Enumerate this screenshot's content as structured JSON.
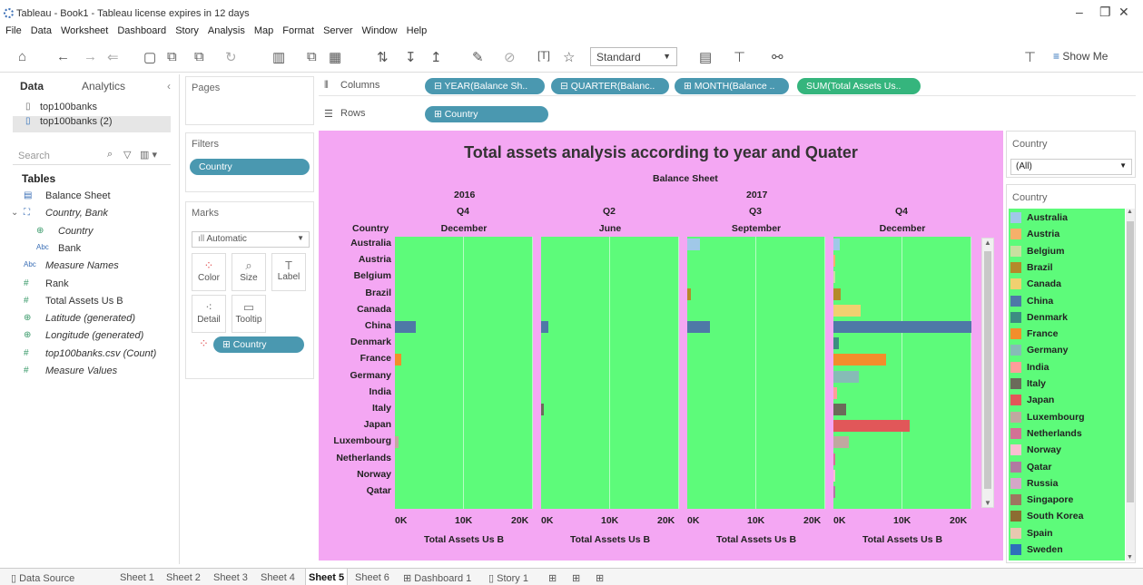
{
  "window": {
    "title": "Tableau - Book1 - Tableau license expires in 12 days"
  },
  "menu": [
    "File",
    "Data",
    "Worksheet",
    "Dashboard",
    "Story",
    "Analysis",
    "Map",
    "Format",
    "Server",
    "Window",
    "Help"
  ],
  "toolbar": {
    "fit": "Standard",
    "show_me": "Show Me"
  },
  "left": {
    "tab_data": "Data",
    "tab_analytics": "Analytics",
    "sources": [
      "top100banks",
      "top100banks (2)"
    ],
    "search_placeholder": "Search",
    "tables_label": "Tables",
    "fields": [
      {
        "icon": "table-icon",
        "label": "Balance Sheet",
        "indent": 0
      },
      {
        "icon": "hierarchy-icon",
        "label": "Country, Bank",
        "indent": 0
      },
      {
        "icon": "globe-icon",
        "label": "Country",
        "indent": 1
      },
      {
        "icon": "abc-icon",
        "label": "Bank",
        "indent": 1
      },
      {
        "icon": "abc-icon",
        "label": "Measure Names",
        "indent": 0
      },
      {
        "icon": "hash-icon",
        "label": "Rank",
        "indent": 0
      },
      {
        "icon": "hash-icon",
        "label": "Total Assets Us B",
        "indent": 0
      },
      {
        "icon": "globe-icon",
        "label": "Latitude (generated)",
        "indent": 0
      },
      {
        "icon": "globe-icon",
        "label": "Longitude (generated)",
        "indent": 0
      },
      {
        "icon": "hash-icon",
        "label": "top100banks.csv (Count)",
        "indent": 0
      },
      {
        "icon": "hash-icon",
        "label": "Measure Values",
        "indent": 0
      }
    ]
  },
  "shelves": {
    "pages": "Pages",
    "filters": "Filters",
    "filter_pill": "Country",
    "marks": "Marks",
    "marks_type": "Automatic",
    "mark_buttons": [
      "Color",
      "Size",
      "Label",
      "Detail",
      "Tooltip"
    ],
    "marks_pill": "Country",
    "columns_label": "Columns",
    "rows_label": "Rows",
    "columns": [
      "YEAR(Balance Sh..",
      "QUARTER(Balanc..",
      "MONTH(Balance ..",
      "SUM(Total Assets Us.."
    ],
    "rows": [
      "Country"
    ]
  },
  "viz": {
    "title": "Total assets analysis according to year and Quater",
    "header_top": "Balance Sheet",
    "row_header": "Country",
    "years": [
      {
        "label": "2016"
      },
      {
        "label": "2017"
      }
    ],
    "panes": [
      {
        "quarter": "Q4",
        "month": "December"
      },
      {
        "quarter": "Q2",
        "month": "June"
      },
      {
        "quarter": "Q3",
        "month": "September"
      },
      {
        "quarter": "Q4",
        "month": "December"
      }
    ],
    "axis_ticks": [
      "0K",
      "10K",
      "20K"
    ],
    "axis_title": "Total Assets Us B"
  },
  "chart_data": {
    "type": "bar",
    "title": "Total assets analysis according to year and Quater",
    "xlabel": "Total Assets Us B",
    "ylabel": "Country",
    "xlim": [
      0,
      20000
    ],
    "categories": [
      "Australia",
      "Austria",
      "Belgium",
      "Brazil",
      "Canada",
      "China",
      "Denmark",
      "France",
      "Germany",
      "India",
      "Italy",
      "Japan",
      "Luxembourg",
      "Netherlands",
      "Norway",
      "Qatar"
    ],
    "series": [
      {
        "values": [
          0,
          0,
          0,
          0,
          0,
          3000,
          0,
          900,
          0,
          0,
          0,
          0,
          500,
          0,
          0,
          0
        ]
      },
      {
        "values": [
          0,
          0,
          0,
          0,
          0,
          1000,
          0,
          0,
          0,
          0,
          400,
          0,
          0,
          0,
          0,
          0
        ]
      },
      {
        "values": [
          1800,
          0,
          0,
          500,
          0,
          3300,
          0,
          0,
          0,
          0,
          0,
          0,
          0,
          0,
          0,
          0
        ]
      },
      {
        "values": [
          900,
          300,
          300,
          1100,
          4000,
          20000,
          800,
          7600,
          3700,
          500,
          1800,
          11100,
          2200,
          300,
          300,
          300
        ]
      }
    ]
  },
  "filter_card": {
    "title": "Country",
    "value": "(All)"
  },
  "legend": {
    "title": "Country",
    "items": [
      {
        "name": "Australia",
        "color": "#a0c8e8"
      },
      {
        "name": "Austria",
        "color": "#f5b06a"
      },
      {
        "name": "Belgium",
        "color": "#c8e0a0"
      },
      {
        "name": "Brazil",
        "color": "#b48a2a"
      },
      {
        "name": "Canada",
        "color": "#f0d070"
      },
      {
        "name": "China",
        "color": "#4e79a7"
      },
      {
        "name": "Denmark",
        "color": "#3c8d82"
      },
      {
        "name": "France",
        "color": "#f28e2b"
      },
      {
        "name": "Germany",
        "color": "#86bcb6"
      },
      {
        "name": "India",
        "color": "#ff9d9a"
      },
      {
        "name": "Italy",
        "color": "#6b6b5a"
      },
      {
        "name": "Japan",
        "color": "#e15759"
      },
      {
        "name": "Luxembourg",
        "color": "#c0a8a0"
      },
      {
        "name": "Netherlands",
        "color": "#d37295"
      },
      {
        "name": "Norway",
        "color": "#fabfd2"
      },
      {
        "name": "Qatar",
        "color": "#b07aa1"
      },
      {
        "name": "Russia",
        "color": "#d4a6c8"
      },
      {
        "name": "Singapore",
        "color": "#9d7660"
      },
      {
        "name": "South Korea",
        "color": "#8c6d31"
      },
      {
        "name": "Spain",
        "color": "#e8c8b0"
      },
      {
        "name": "Sweden",
        "color": "#2e6fba"
      }
    ]
  },
  "bottom_tabs": {
    "data_source": "Data Source",
    "sheets": [
      "Sheet 1",
      "Sheet 2",
      "Sheet 3",
      "Sheet 4",
      "Sheet 5",
      "Sheet 6",
      "Dashboard 1",
      "Story 1"
    ],
    "active": "Sheet 5"
  }
}
